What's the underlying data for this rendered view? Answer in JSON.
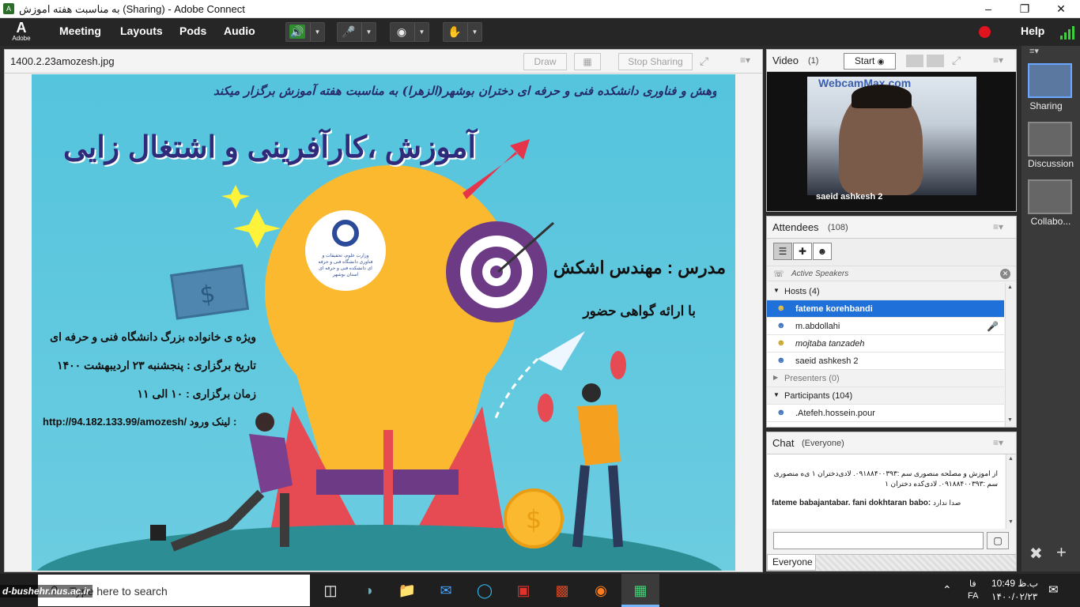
{
  "window": {
    "title": "به مناسبت هفته اموزش (Sharing) - Adobe Connect"
  },
  "menubar": {
    "logo_text": "Adobe",
    "items": [
      "Meeting",
      "Layouts",
      "Pods",
      "Audio"
    ],
    "help": "Help"
  },
  "share_pod": {
    "file_name": "1400.2.23amozesh.jpg",
    "draw": "Draw",
    "stop_sharing": "Stop Sharing"
  },
  "slide": {
    "header": "حوزه معاونت آموزش ، پژوهش و فناوری دانشکده فنی و حرفه ای دختران بوشهر(الزهرا) به مناسبت هفته آموزش برگزار میکند",
    "headline": "آموزش ،کارآفرینی و اشتغال زایی",
    "logo_text": "وزارت علوم، تحقیقات و فناوری دانشگاه فنی و حرفه ای دانشکده فنی و حرفه ای استان بوشهر",
    "teacher": "مدرس : مهندس اشکش",
    "certificate": "با ارائه گواهی حضور",
    "audience": "ویژه ی خانواده بزرگ دانشگاه فنی و حرفه ای",
    "date": "تاریخ برگزاری : پنجشنبه ۲۳ اردیبهشت ۱۴۰۰",
    "time": "زمان برگزاری : ۱۰ الی ۱۱",
    "link_label": "لینک ورود :",
    "link": "http://94.182.133.99/amozesh/"
  },
  "video_pod": {
    "title": "Video",
    "count": "(1)",
    "start": "Start",
    "person": "saeid ashkesh 2",
    "webcam_brand": "WebcamMax.com"
  },
  "attendees_pod": {
    "title": "Attendees",
    "count": "(108)",
    "active_speakers": "Active Speakers",
    "hosts": {
      "label": "Hosts (4)",
      "members": [
        "fateme korehbandi",
        "m.abdollahi",
        "mojtaba tanzadeh",
        "saeid ashkesh 2"
      ]
    },
    "presenters": {
      "label": "Presenters (0)"
    },
    "participants": {
      "label": "Participants (104)",
      "members": [
        ".Atefeh.hossein.pour"
      ]
    }
  },
  "chat_pod": {
    "title": "Chat",
    "scope": "(Everyone)",
    "messages": [
      {
        "text": "از اموزش و مصلحه منصوری سم :۰۹۱۸۸۴۰۰۳۹۳. لادی‌دختران ۱ ی‌ه منصوری سم :۰۹۱۸۸۴۰۰۳۹۳. لادی‌کده دختران ۱",
        "sender": ""
      },
      {
        "sender": "fateme babajantabar. fani dokhtaran babo:",
        "text": "صدا ندارد"
      }
    ],
    "audience": "Everyone"
  },
  "rail": {
    "items": [
      "Sharing",
      "Discussion",
      "Collabo..."
    ]
  },
  "taskbar": {
    "search_placeholder": "Type here to search",
    "watermark": "d-bushehr.nus.ac.ir",
    "time": "10:49 ب.ظ",
    "date": "۱۴۰۰/۰۲/۲۳",
    "lang": "FA",
    "lang_fa": "فا"
  },
  "colors": {
    "accent_blue": "#1f70d9",
    "menubar": "#262626",
    "rec": "#e0141e",
    "slide_bg": "#5cc6de",
    "bulb": "#fbb92f",
    "target": "#6d3b86"
  }
}
